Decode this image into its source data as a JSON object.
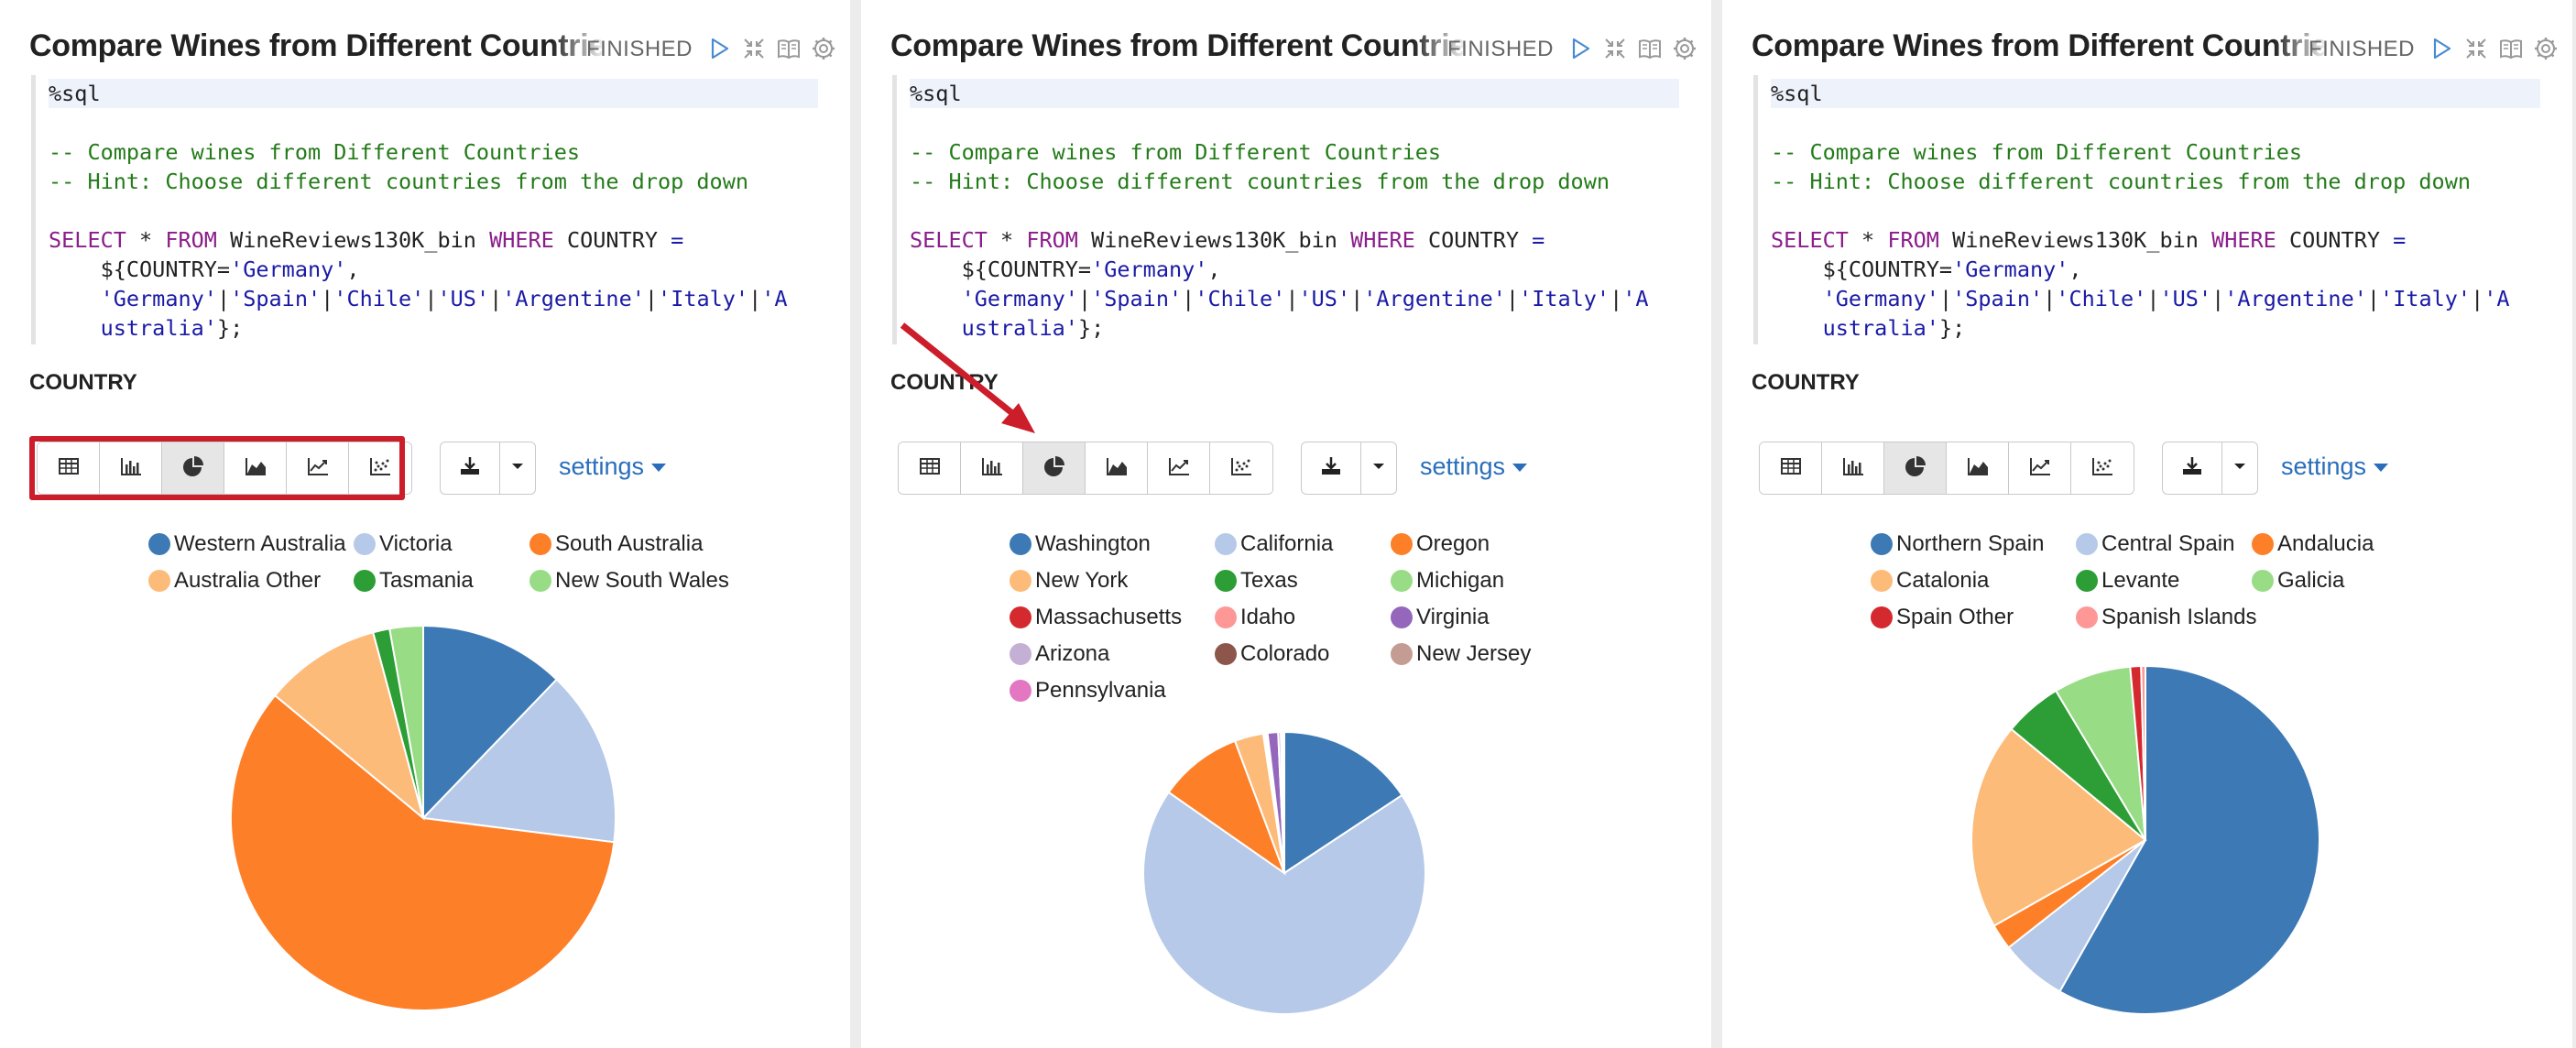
{
  "panels": [
    {
      "id": "left",
      "title": "Compare Wines from Different Countries",
      "status": "FINISHED",
      "form_label": "COUNTRY",
      "settings_label": "settings",
      "code": [
        {
          "parts": [
            {
              "t": "%sql",
              "c": ""
            }
          ]
        },
        {
          "parts": []
        },
        {
          "parts": [
            {
              "t": "-- Compare wines from Different Countries",
              "c": "cmt"
            }
          ]
        },
        {
          "parts": [
            {
              "t": "-- Hint: Choose different countries from the drop down",
              "c": "cmt"
            }
          ]
        },
        {
          "parts": []
        },
        {
          "parts": [
            {
              "t": "SELECT",
              "c": "kw"
            },
            {
              "t": " * ",
              "c": ""
            },
            {
              "t": "FROM",
              "c": "kw"
            },
            {
              "t": " WineReviews130K_bin ",
              "c": ""
            },
            {
              "t": "WHERE",
              "c": "kw"
            },
            {
              "t": " COUNTRY ",
              "c": ""
            },
            {
              "t": "=",
              "c": "str"
            }
          ]
        },
        {
          "parts": [
            {
              "t": "    ${COUNTRY=",
              "c": ""
            },
            {
              "t": "'Germany'",
              "c": "str"
            },
            {
              "t": ",",
              "c": ""
            }
          ]
        },
        {
          "parts": [
            {
              "t": "    'Germany'",
              "c": "str"
            },
            {
              "t": "|",
              "c": ""
            },
            {
              "t": "'Spain'",
              "c": "str"
            },
            {
              "t": "|",
              "c": ""
            },
            {
              "t": "'Chile'",
              "c": "str"
            },
            {
              "t": "|",
              "c": ""
            },
            {
              "t": "'US'",
              "c": "str"
            },
            {
              "t": "|",
              "c": ""
            },
            {
              "t": "'Argentine'",
              "c": "str"
            },
            {
              "t": "|",
              "c": ""
            },
            {
              "t": "'Italy'",
              "c": "str"
            },
            {
              "t": "|",
              "c": ""
            },
            {
              "t": "'A",
              "c": "str"
            }
          ]
        },
        {
          "parts": [
            {
              "t": "    ustralia'",
              "c": "str"
            },
            {
              "t": "};",
              "c": ""
            }
          ]
        }
      ],
      "chart_data": {
        "type": "pie",
        "categories": [
          "Western Australia",
          "Victoria",
          "South Australia",
          "Australia Other",
          "Tasmania",
          "New South Wales"
        ],
        "values": [
          12.2,
          14.8,
          59.0,
          9.8,
          1.4,
          2.8
        ],
        "colors": [
          "#3d7ab5",
          "#b6c9e8",
          "#fd7f28",
          "#fdbb7a",
          "#2c9e35",
          "#98dc86"
        ],
        "start_angle_deg": 0
      }
    },
    {
      "id": "middle",
      "title": "Compare Wines from Different Countries",
      "status": "FINISHED",
      "form_label": "COUNTRY",
      "settings_label": "settings",
      "code": [
        {
          "parts": [
            {
              "t": "%sql",
              "c": ""
            }
          ]
        },
        {
          "parts": []
        },
        {
          "parts": [
            {
              "t": "-- Compare wines from Different Countries",
              "c": "cmt"
            }
          ]
        },
        {
          "parts": [
            {
              "t": "-- Hint: Choose different countries from the drop down",
              "c": "cmt"
            }
          ]
        },
        {
          "parts": []
        },
        {
          "parts": [
            {
              "t": "SELECT",
              "c": "kw"
            },
            {
              "t": " * ",
              "c": ""
            },
            {
              "t": "FROM",
              "c": "kw"
            },
            {
              "t": " WineReviews130K_bin ",
              "c": ""
            },
            {
              "t": "WHERE",
              "c": "kw"
            },
            {
              "t": " COUNTRY ",
              "c": ""
            },
            {
              "t": "=",
              "c": "str"
            }
          ]
        },
        {
          "parts": [
            {
              "t": "    ${COUNTRY=",
              "c": ""
            },
            {
              "t": "'Germany'",
              "c": "str"
            },
            {
              "t": ",",
              "c": ""
            }
          ]
        },
        {
          "parts": [
            {
              "t": "    'Germany'",
              "c": "str"
            },
            {
              "t": "|",
              "c": ""
            },
            {
              "t": "'Spain'",
              "c": "str"
            },
            {
              "t": "|",
              "c": ""
            },
            {
              "t": "'Chile'",
              "c": "str"
            },
            {
              "t": "|",
              "c": ""
            },
            {
              "t": "'US'",
              "c": "str"
            },
            {
              "t": "|",
              "c": ""
            },
            {
              "t": "'Argentine'",
              "c": "str"
            },
            {
              "t": "|",
              "c": ""
            },
            {
              "t": "'Italy'",
              "c": "str"
            },
            {
              "t": "|",
              "c": ""
            },
            {
              "t": "'A",
              "c": "str"
            }
          ]
        },
        {
          "parts": [
            {
              "t": "    ustralia'",
              "c": "str"
            },
            {
              "t": "};",
              "c": ""
            }
          ]
        }
      ],
      "chart_data": {
        "type": "pie",
        "categories": [
          "Washington",
          "California",
          "Oregon",
          "New York",
          "Texas",
          "Michigan",
          "Massachusetts",
          "Idaho",
          "Virginia",
          "Arizona",
          "Colorado",
          "New Jersey",
          "Pennsylvania"
        ],
        "values": [
          15.7,
          69.0,
          9.6,
          3.3,
          0.1,
          0.1,
          0.1,
          0.2,
          1.2,
          0.3,
          0.2,
          0.1,
          0.1
        ],
        "colors": [
          "#3d7ab5",
          "#b6c9e8",
          "#fd7f28",
          "#fdbb7a",
          "#2c9e35",
          "#98dc86",
          "#d42a2f",
          "#fd9896",
          "#9467bd",
          "#c5b0d5",
          "#8c564b",
          "#c49c94",
          "#e377c2"
        ],
        "start_angle_deg": 0
      }
    },
    {
      "id": "right",
      "title": "Compare Wines from Different Countries",
      "status": "FINISHED",
      "form_label": "COUNTRY",
      "settings_label": "settings",
      "code": [
        {
          "parts": [
            {
              "t": "%sql",
              "c": ""
            }
          ]
        },
        {
          "parts": []
        },
        {
          "parts": [
            {
              "t": "-- Compare wines from Different Countries",
              "c": "cmt"
            }
          ]
        },
        {
          "parts": [
            {
              "t": "-- Hint: Choose different countries from the drop down",
              "c": "cmt"
            }
          ]
        },
        {
          "parts": []
        },
        {
          "parts": [
            {
              "t": "SELECT",
              "c": "kw"
            },
            {
              "t": " * ",
              "c": ""
            },
            {
              "t": "FROM",
              "c": "kw"
            },
            {
              "t": " WineReviews130K_bin ",
              "c": ""
            },
            {
              "t": "WHERE",
              "c": "kw"
            },
            {
              "t": " COUNTRY ",
              "c": ""
            },
            {
              "t": "=",
              "c": "str"
            }
          ]
        },
        {
          "parts": [
            {
              "t": "    ${COUNTRY=",
              "c": ""
            },
            {
              "t": "'Germany'",
              "c": "str"
            },
            {
              "t": ",",
              "c": ""
            }
          ]
        },
        {
          "parts": [
            {
              "t": "    'Germany'",
              "c": "str"
            },
            {
              "t": "|",
              "c": ""
            },
            {
              "t": "'Spain'",
              "c": "str"
            },
            {
              "t": "|",
              "c": ""
            },
            {
              "t": "'Chile'",
              "c": "str"
            },
            {
              "t": "|",
              "c": ""
            },
            {
              "t": "'US'",
              "c": "str"
            },
            {
              "t": "|",
              "c": ""
            },
            {
              "t": "'Argentine'",
              "c": "str"
            },
            {
              "t": "|",
              "c": ""
            },
            {
              "t": "'Italy'",
              "c": "str"
            },
            {
              "t": "|",
              "c": ""
            },
            {
              "t": "'A",
              "c": "str"
            }
          ]
        },
        {
          "parts": [
            {
              "t": "    ustralia'",
              "c": "str"
            },
            {
              "t": "};",
              "c": ""
            }
          ]
        }
      ],
      "chart_data": {
        "type": "pie",
        "categories": [
          "Northern Spain",
          "Central Spain",
          "Andalucia",
          "Catalonia",
          "Levante",
          "Galicia",
          "Spain Other",
          "Spanish Islands"
        ],
        "values": [
          58.2,
          6.2,
          2.4,
          19.2,
          5.4,
          7.2,
          1.0,
          0.4
        ],
        "colors": [
          "#3d7ab5",
          "#b6c9e8",
          "#fd7f28",
          "#fdbb7a",
          "#2c9e35",
          "#98dc86",
          "#d42a2f",
          "#fd9896"
        ],
        "start_angle_deg": 0
      }
    }
  ],
  "toolbar": {
    "view_buttons": [
      "table-icon",
      "bar-chart-icon",
      "pie-chart-icon",
      "area-chart-icon",
      "line-chart-icon",
      "scatter-chart-icon"
    ],
    "active_view": "pie-chart-icon",
    "action_icons": [
      "run-icon",
      "collapse-icon",
      "book-icon",
      "gear-icon"
    ]
  },
  "annotations": {
    "highlight_color": "#cc1d2a",
    "arrow_color": "#cc1d2a"
  }
}
